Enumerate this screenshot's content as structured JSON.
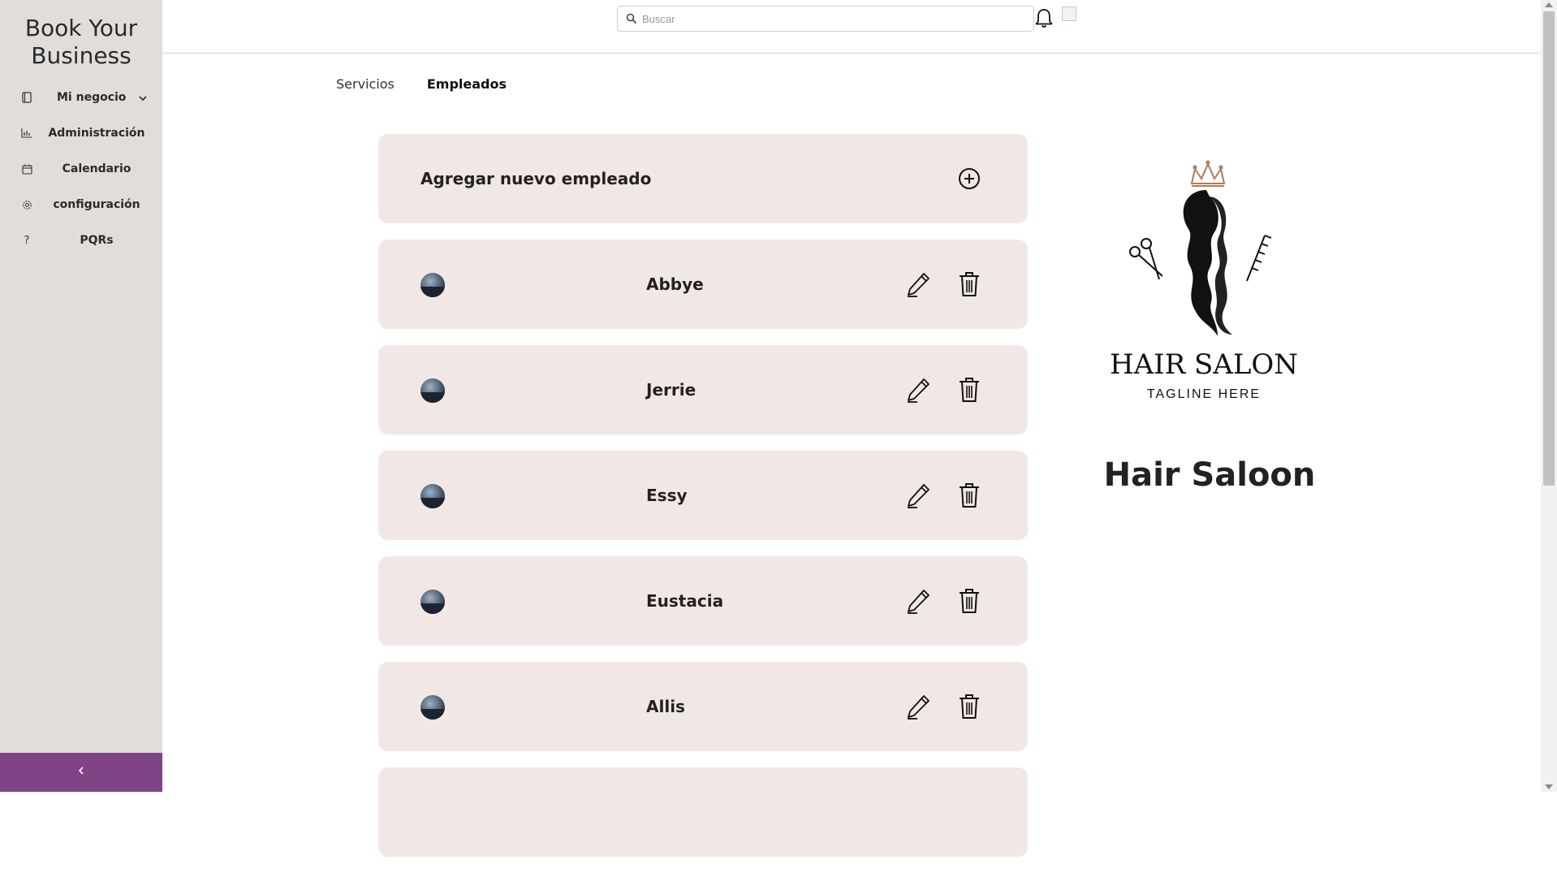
{
  "app": {
    "brand": "Book Your Business"
  },
  "sidebar": {
    "items": [
      {
        "label": "Mi negocio",
        "icon": "book-icon"
      },
      {
        "label": "Administración",
        "icon": "chart-icon"
      },
      {
        "label": "Calendario",
        "icon": "calendar-icon"
      },
      {
        "label": "configuración",
        "icon": "gear-icon"
      },
      {
        "label": "PQRs",
        "icon": "question-icon"
      }
    ],
    "collapse_icon": "chevron-left-icon"
  },
  "header": {
    "search": {
      "placeholder": "Buscar",
      "value": ""
    },
    "bell_icon": "bell-icon"
  },
  "tabs": [
    {
      "label": "Servicios",
      "active": false
    },
    {
      "label": "Empleados",
      "active": true
    }
  ],
  "add_employee": {
    "label": "Agregar nuevo empleado",
    "icon": "plus-circle-icon"
  },
  "employees": [
    {
      "name": "Abbye"
    },
    {
      "name": "Jerrie"
    },
    {
      "name": "Essy"
    },
    {
      "name": "Eustacia"
    },
    {
      "name": "Allis"
    }
  ],
  "business": {
    "name": "Hair Saloon",
    "logo_title": "HAIR SALON",
    "logo_tagline": "TAGLINE HERE"
  },
  "colors": {
    "sidebar_bg": "#e1dddb",
    "collapse_bar": "#7e4486",
    "card_bg": "#f1e8e5"
  }
}
